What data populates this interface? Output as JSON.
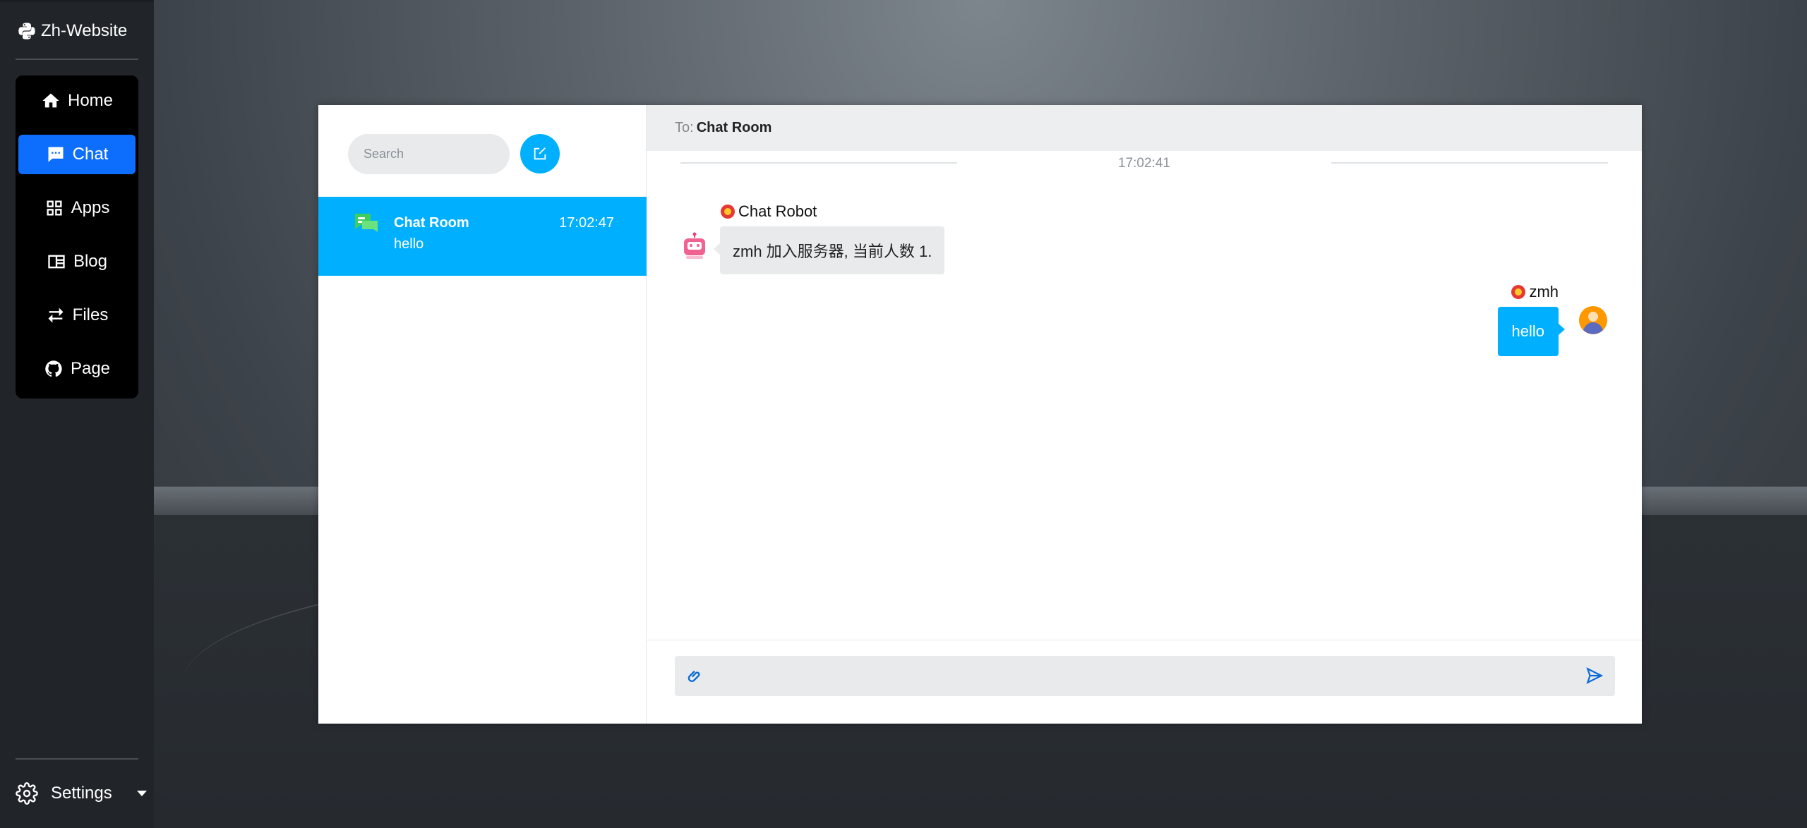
{
  "app": {
    "brand": "Zh-Website"
  },
  "sidebar": {
    "items": [
      {
        "label": "Home",
        "icon": "home-icon",
        "active": false
      },
      {
        "label": "Chat",
        "icon": "chat-icon",
        "active": true
      },
      {
        "label": "Apps",
        "icon": "apps-grid-icon",
        "active": false
      },
      {
        "label": "Blog",
        "icon": "blog-icon",
        "active": false
      },
      {
        "label": "Files",
        "icon": "transfer-arrows-icon",
        "active": false
      },
      {
        "label": "Page",
        "icon": "github-icon",
        "active": false
      }
    ],
    "settings_label": "Settings"
  },
  "chat": {
    "search_placeholder": "Search",
    "conversations": [
      {
        "name": "Chat Room",
        "time": "17:02:47",
        "preview": "hello",
        "selected": true
      }
    ],
    "header": {
      "to_label": "To:",
      "to_name": "Chat Room"
    },
    "time_separator": "17:02:41",
    "messages": [
      {
        "sender": "Chat Robot",
        "text": "zmh 加入服务器, 当前人数 1.",
        "side": "left"
      },
      {
        "sender": "zmh",
        "text": "hello",
        "side": "right"
      }
    ],
    "input_value": ""
  },
  "colors": {
    "sidebar_bg": "#212529",
    "nav_active": "#0d6efd",
    "accent": "#00b0ff",
    "bubble_gray": "#e8eaec"
  }
}
